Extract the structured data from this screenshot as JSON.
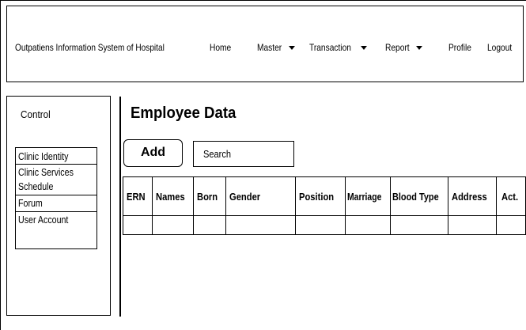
{
  "header": {
    "app_title": "Outpatiens Information System of Hospital",
    "nav": [
      {
        "label": "Home",
        "dropdown": false
      },
      {
        "label": "Master",
        "dropdown": true
      },
      {
        "label": "Transaction",
        "dropdown": true
      },
      {
        "label": "Report",
        "dropdown": true
      },
      {
        "label": "Profile",
        "dropdown": false
      },
      {
        "label": "Logout",
        "dropdown": false
      }
    ]
  },
  "sidebar": {
    "title": "Control",
    "items": [
      {
        "label": "Clinic Identity"
      },
      {
        "label_line1": "Clinic Services",
        "label_line2": "Schedule"
      },
      {
        "label": "Forum"
      },
      {
        "label": "User Account"
      }
    ]
  },
  "main": {
    "title": "Employee Data",
    "add_label": "Add",
    "search_placeholder": "Search",
    "table": {
      "columns": [
        "ERN",
        "Names",
        "Born",
        "Gender",
        "Position",
        "Marriage",
        "Blood Type",
        "Address",
        "Act."
      ],
      "rows": [
        [
          "",
          "",
          "",
          "",
          "",
          "",
          "",
          "",
          ""
        ]
      ]
    }
  }
}
